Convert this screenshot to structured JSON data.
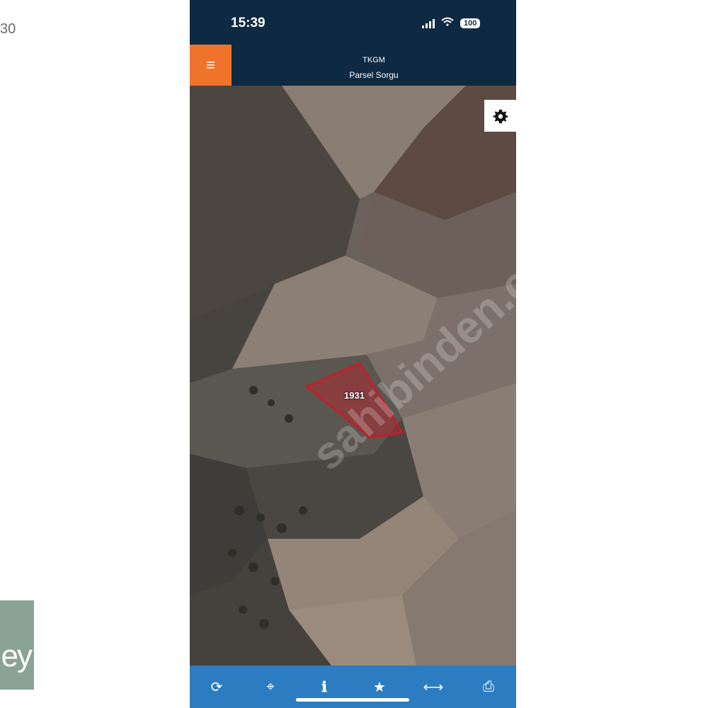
{
  "side": {
    "time_fragment": "30",
    "logo_fragment": "ey"
  },
  "status_bar": {
    "time": "15:39",
    "battery": "100"
  },
  "header": {
    "title": "TKGM",
    "subtitle": "Parsel Sorgu"
  },
  "map": {
    "parcel_label": "1931",
    "watermark": "sahibinden.com"
  },
  "toolbar": {
    "items": [
      "refresh-icon",
      "location-icon",
      "info-icon",
      "star-icon",
      "measure-icon",
      "print-icon"
    ]
  },
  "colors": {
    "header_bg": "#0e2a42",
    "menu_accent": "#f0732b",
    "toolbar_bg": "#2c7cc1",
    "parcel_outline": "#c0202a"
  }
}
